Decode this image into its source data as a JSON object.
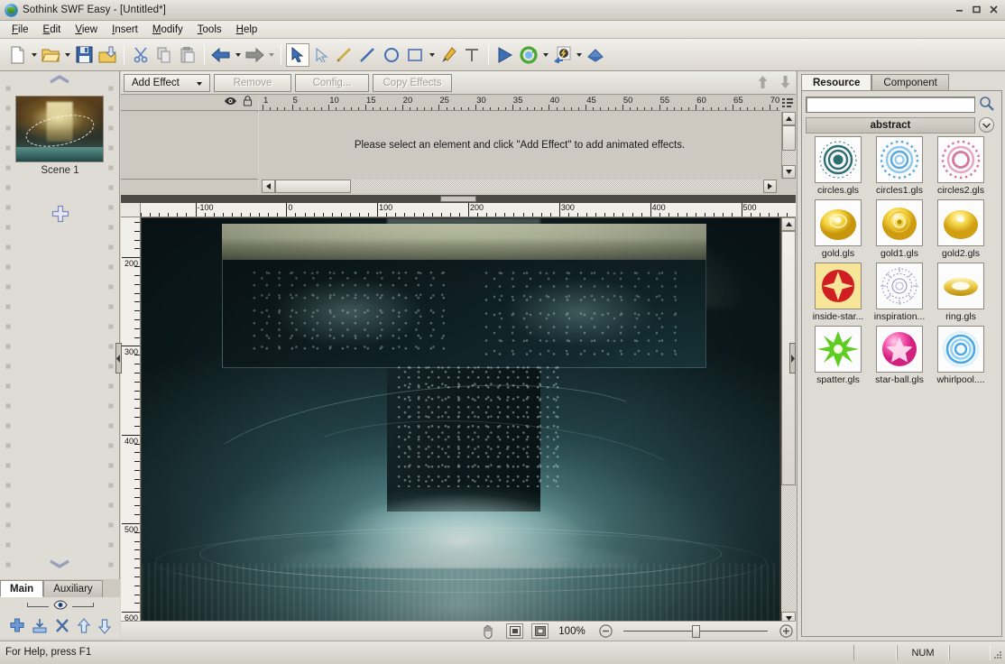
{
  "window": {
    "title": "Sothink SWF Easy - [Untitled*]",
    "icon": "app-icon",
    "minimize": "–",
    "maximize": "▭",
    "close": "×"
  },
  "menubar": {
    "items": [
      {
        "label": "File",
        "accel": "F"
      },
      {
        "label": "Edit",
        "accel": "E"
      },
      {
        "label": "View",
        "accel": "V"
      },
      {
        "label": "Insert",
        "accel": "I"
      },
      {
        "label": "Modify",
        "accel": "M"
      },
      {
        "label": "Tools",
        "accel": "T"
      },
      {
        "label": "Help",
        "accel": "H"
      }
    ]
  },
  "toolbar": {
    "groups": [
      [
        "new-document-icon",
        "dropdown-caret",
        "open-folder-icon",
        "dropdown-caret",
        "save-icon",
        "export-icon"
      ],
      [
        "cut-scissors-icon",
        "copy-icon",
        "paste-icon"
      ],
      [
        "undo-arrow-icon",
        "dropdown-caret",
        "redo-arrow-icon",
        "dropdown-caret"
      ],
      [
        "select-arrow-icon",
        "subselect-arrow-icon",
        "pencil-icon",
        "line-icon",
        "ellipse-icon",
        "rectangle-icon",
        "dropdown-caret",
        "pen-icon",
        "text-icon"
      ],
      [
        "play-icon",
        "refresh-icon",
        "flash-export-icon",
        "dropdown-caret",
        "publish-icon"
      ]
    ],
    "selected_tool": "select-arrow-icon"
  },
  "scenes": {
    "collapse_up": "chevron-up-icon",
    "collapse_down": "chevron-down-icon",
    "scene_label": "Scene 1",
    "add_scene": "add-plus-icon",
    "tabs": [
      {
        "label": "Main",
        "active": true
      },
      {
        "label": "Auxiliary",
        "active": false
      }
    ],
    "visibility_icon": "eye-icon",
    "actions": [
      "add-plus-icon",
      "import-icon",
      "delete-x-icon",
      "move-up-icon",
      "move-down-icon"
    ]
  },
  "effects_bar": {
    "buttons": [
      {
        "label": "Add Effect",
        "enabled": true,
        "has_caret": true
      },
      {
        "label": "Remove",
        "enabled": false,
        "has_caret": false
      },
      {
        "label": "Config...",
        "enabled": false,
        "has_caret": false
      },
      {
        "label": "Copy Effects",
        "enabled": false,
        "has_caret": false
      }
    ],
    "move_up": "arrow-up-icon",
    "move_down": "arrow-down-icon"
  },
  "timeline": {
    "layer_header_icons": [
      "eye-icon",
      "lock-icon"
    ],
    "message": "Please select an element and click \"Add Effect\" to add animated effects.",
    "ruler_labels": [
      1,
      5,
      10,
      15,
      20,
      25,
      30,
      35,
      40,
      45,
      50,
      55,
      60,
      65,
      70
    ],
    "ruler_start": 1,
    "ruler_end": 72,
    "list_icon": "frame-list-icon",
    "scroll_up": "scroll-up-arrow",
    "scroll_down": "scroll-down-arrow",
    "scroll_left": "scroll-left-arrow",
    "scroll_right": "scroll-right-arrow"
  },
  "stage": {
    "ruler_h_labels": [
      -100,
      0,
      100,
      200,
      300,
      400,
      500
    ],
    "ruler_h_min": -160,
    "ruler_h_max": 560,
    "ruler_v_labels": [
      200,
      300,
      400,
      500,
      600
    ],
    "ruler_v_min": 155,
    "ruler_v_max": 615,
    "artwork_description": "dark teal water splash with ornate filigree cross"
  },
  "zoom_bar": {
    "hand_tool": "hand-icon",
    "fit_page": "fit-page-icon",
    "fit_width": "fit-selection-icon",
    "zoom_level": "100%",
    "zoom_out": "zoom-out-icon",
    "zoom_in": "zoom-in-icon",
    "slider_value": 50
  },
  "dock": {
    "tabs": [
      {
        "label": "Resource",
        "active": true
      },
      {
        "label": "Component",
        "active": false
      }
    ],
    "search": {
      "value": "",
      "placeholder": "",
      "icon": "search-magnifier-icon"
    },
    "category": {
      "label": "abstract",
      "dropdown_icon": "chevron-down-circle-icon"
    },
    "items": [
      {
        "name": "circles.gls",
        "thumb": "circles-teal"
      },
      {
        "name": "circles1.gls",
        "thumb": "circles-blue"
      },
      {
        "name": "circles2.gls",
        "thumb": "circles-pink"
      },
      {
        "name": "gold.gls",
        "thumb": "gold-coin"
      },
      {
        "name": "gold1.gls",
        "thumb": "gold-coin-1"
      },
      {
        "name": "gold2.gls",
        "thumb": "gold-dome"
      },
      {
        "name": "inside-star...",
        "thumb": "red-star"
      },
      {
        "name": "inspiration...",
        "thumb": "purple-burst"
      },
      {
        "name": "ring.gls",
        "thumb": "gold-ring"
      },
      {
        "name": "spatter.gls",
        "thumb": "green-spatter"
      },
      {
        "name": "star-ball.gls",
        "thumb": "pink-star-ball"
      },
      {
        "name": "whirlpool....",
        "thumb": "blue-whirlpool"
      }
    ]
  },
  "statusbar": {
    "help_text": "For Help, press F1",
    "indicators": [
      "",
      "NUM",
      ""
    ],
    "grip": "resize-grip"
  }
}
